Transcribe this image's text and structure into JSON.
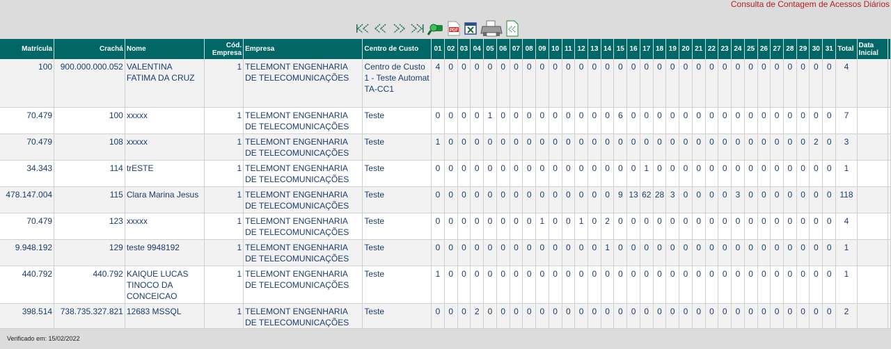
{
  "page": {
    "title": "Consulta de Contagem de Acessos Diários"
  },
  "toolbar": [
    {
      "name": "first-page-icon"
    },
    {
      "name": "previous-page-icon"
    },
    {
      "name": "next-page-icon"
    },
    {
      "name": "last-page-icon"
    },
    {
      "name": "search-icon"
    },
    {
      "name": "pdf-export-icon"
    },
    {
      "name": "excel-export-icon"
    },
    {
      "name": "print-icon"
    },
    {
      "name": "xml-export-icon"
    }
  ],
  "table": {
    "headers": {
      "matricula": "Matrícula",
      "cracha": "Crachá",
      "nome": "Nome",
      "cod_empresa": "Cód. Empresa",
      "empresa": "Empresa",
      "centro_custo": "Centro de Custo",
      "days": [
        "01",
        "02",
        "03",
        "04",
        "05",
        "06",
        "07",
        "08",
        "09",
        "10",
        "11",
        "12",
        "13",
        "14",
        "15",
        "16",
        "17",
        "18",
        "19",
        "20",
        "21",
        "22",
        "23",
        "24",
        "25",
        "26",
        "27",
        "28",
        "29",
        "30",
        "31"
      ],
      "total": "Total",
      "data_inicial": "Data Inicial"
    },
    "rows": [
      {
        "matricula": "100",
        "cracha": "900.000.000.052",
        "nome": "VALENTINA FATIMA DA CRUZ",
        "cod": "1",
        "empresa": "TELEMONT ENGENHARIA DE TELECOMUNICAÇÕES",
        "centro": "Centro de Custo 1 - Teste Automat TA-CC1",
        "days": [
          "4",
          "0",
          "0",
          "0",
          "0",
          "0",
          "0",
          "0",
          "0",
          "0",
          "0",
          "0",
          "0",
          "0",
          "0",
          "0",
          "0",
          "0",
          "0",
          "0",
          "0",
          "0",
          "0",
          "0",
          "0",
          "0",
          "0",
          "0",
          "0",
          "0",
          "0"
        ],
        "total": "4"
      },
      {
        "matricula": "70.479",
        "cracha": "100",
        "nome": "xxxxx",
        "cod": "1",
        "empresa": "TELEMONT ENGENHARIA DE TELECOMUNICAÇÕES",
        "centro": "Teste",
        "days": [
          "0",
          "0",
          "0",
          "0",
          "1",
          "0",
          "0",
          "0",
          "0",
          "0",
          "0",
          "0",
          "0",
          "0",
          "6",
          "0",
          "0",
          "0",
          "0",
          "0",
          "0",
          "0",
          "0",
          "0",
          "0",
          "0",
          "0",
          "0",
          "0",
          "0",
          "0"
        ],
        "total": "7"
      },
      {
        "matricula": "70.479",
        "cracha": "108",
        "nome": "xxxxx",
        "cod": "1",
        "empresa": "TELEMONT ENGENHARIA DE TELECOMUNICAÇÕES",
        "centro": "Teste",
        "days": [
          "1",
          "0",
          "0",
          "0",
          "0",
          "0",
          "0",
          "0",
          "0",
          "0",
          "0",
          "0",
          "0",
          "0",
          "0",
          "0",
          "0",
          "0",
          "0",
          "0",
          "0",
          "0",
          "0",
          "0",
          "0",
          "0",
          "0",
          "0",
          "0",
          "2",
          "0"
        ],
        "total": "3"
      },
      {
        "matricula": "34.343",
        "cracha": "114",
        "nome": "trESTE",
        "cod": "1",
        "empresa": "TELEMONT ENGENHARIA DE TELECOMUNICAÇÕES",
        "centro": "Teste",
        "days": [
          "0",
          "0",
          "0",
          "0",
          "0",
          "0",
          "0",
          "0",
          "0",
          "0",
          "0",
          "0",
          "0",
          "0",
          "0",
          "0",
          "1",
          "0",
          "0",
          "0",
          "0",
          "0",
          "0",
          "0",
          "0",
          "0",
          "0",
          "0",
          "0",
          "0",
          "0"
        ],
        "total": "1"
      },
      {
        "matricula": "478.147.004",
        "cracha": "115",
        "nome": "Clara Marina Jesus",
        "cod": "1",
        "empresa": "TELEMONT ENGENHARIA DE TELECOMUNICAÇÕES",
        "centro": "Teste",
        "days": [
          "0",
          "0",
          "0",
          "0",
          "0",
          "0",
          "0",
          "0",
          "0",
          "0",
          "0",
          "0",
          "0",
          "0",
          "9",
          "13",
          "62",
          "28",
          "3",
          "0",
          "0",
          "0",
          "0",
          "3",
          "0",
          "0",
          "0",
          "0",
          "0",
          "0",
          "0"
        ],
        "total": "118"
      },
      {
        "matricula": "70.479",
        "cracha": "123",
        "nome": "xxxxx",
        "cod": "1",
        "empresa": "TELEMONT ENGENHARIA DE TELECOMUNICAÇÕES",
        "centro": "Teste",
        "days": [
          "0",
          "0",
          "0",
          "0",
          "0",
          "0",
          "0",
          "0",
          "1",
          "0",
          "0",
          "1",
          "0",
          "2",
          "0",
          "0",
          "0",
          "0",
          "0",
          "0",
          "0",
          "0",
          "0",
          "0",
          "0",
          "0",
          "0",
          "0",
          "0",
          "0",
          "0"
        ],
        "total": "4"
      },
      {
        "matricula": "9.948.192",
        "cracha": "129",
        "nome": "teste 9948192",
        "cod": "1",
        "empresa": "TELEMONT ENGENHARIA DE TELECOMUNICAÇÕES",
        "centro": "Teste",
        "days": [
          "0",
          "0",
          "0",
          "0",
          "0",
          "0",
          "0",
          "0",
          "0",
          "0",
          "0",
          "0",
          "0",
          "1",
          "0",
          "0",
          "0",
          "0",
          "0",
          "0",
          "0",
          "0",
          "0",
          "0",
          "0",
          "0",
          "0",
          "0",
          "0",
          "0",
          "0"
        ],
        "total": "1"
      },
      {
        "matricula": "440.792",
        "cracha": "440.792",
        "nome": "KAIQUE LUCAS TINOCO DA CONCEICAO",
        "cod": "1",
        "empresa": "TELEMONT ENGENHARIA DE TELECOMUNICAÇÕES",
        "centro": "Teste",
        "days": [
          "1",
          "0",
          "0",
          "0",
          "0",
          "0",
          "0",
          "0",
          "0",
          "0",
          "0",
          "0",
          "0",
          "0",
          "0",
          "0",
          "0",
          "0",
          "0",
          "0",
          "0",
          "0",
          "0",
          "0",
          "0",
          "0",
          "0",
          "0",
          "0",
          "0",
          "0"
        ],
        "total": "1"
      },
      {
        "matricula": "398.514",
        "cracha": "738.735.327.821",
        "nome": "12683 MSSQL",
        "cod": "1",
        "empresa": "TELEMONT ENGENHARIA DE TELECOMUNICAÇÕES",
        "centro": "Teste",
        "days": [
          "0",
          "0",
          "0",
          "2",
          "0",
          "0",
          "0",
          "0",
          "0",
          "0",
          "0",
          "0",
          "0",
          "0",
          "0",
          "0",
          "0",
          "0",
          "0",
          "0",
          "0",
          "0",
          "0",
          "0",
          "0",
          "0",
          "0",
          "0",
          "0",
          "0",
          "0"
        ],
        "total": "2"
      }
    ]
  },
  "footer": {
    "verified": "Verificado em: 15/02/2022"
  }
}
